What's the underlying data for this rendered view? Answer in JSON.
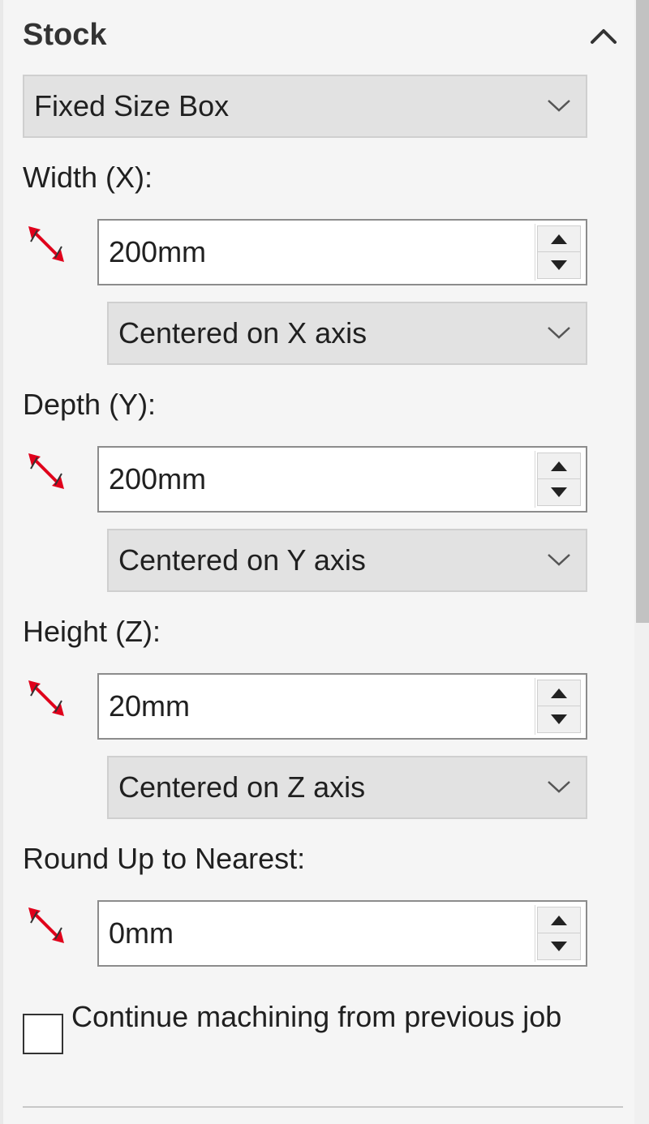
{
  "section": {
    "title": "Stock",
    "collapse_icon": "chevron-up-icon"
  },
  "stock_type": {
    "value": "Fixed Size Box",
    "icon": "chevron-down-icon"
  },
  "width": {
    "label": "Width (X):",
    "value": "200mm",
    "placement": "Centered on X axis",
    "icon": "dimension-arrow-icon"
  },
  "depth": {
    "label": "Depth (Y):",
    "value": "200mm",
    "placement": "Centered on Y axis",
    "icon": "dimension-arrow-icon"
  },
  "height": {
    "label": "Height (Z):",
    "value": "20mm",
    "placement": "Centered on Z axis",
    "icon": "dimension-arrow-icon"
  },
  "round_up": {
    "label": "Round Up to Nearest:",
    "value": "0mm",
    "icon": "dimension-arrow-icon"
  },
  "continue_machining": {
    "label": "Continue machining from previous job",
    "checked": false
  },
  "colors": {
    "panel_background": "#f5f5f5",
    "dimension_icon": "#e0001b",
    "dropdown_background": "#e2e2e2"
  }
}
